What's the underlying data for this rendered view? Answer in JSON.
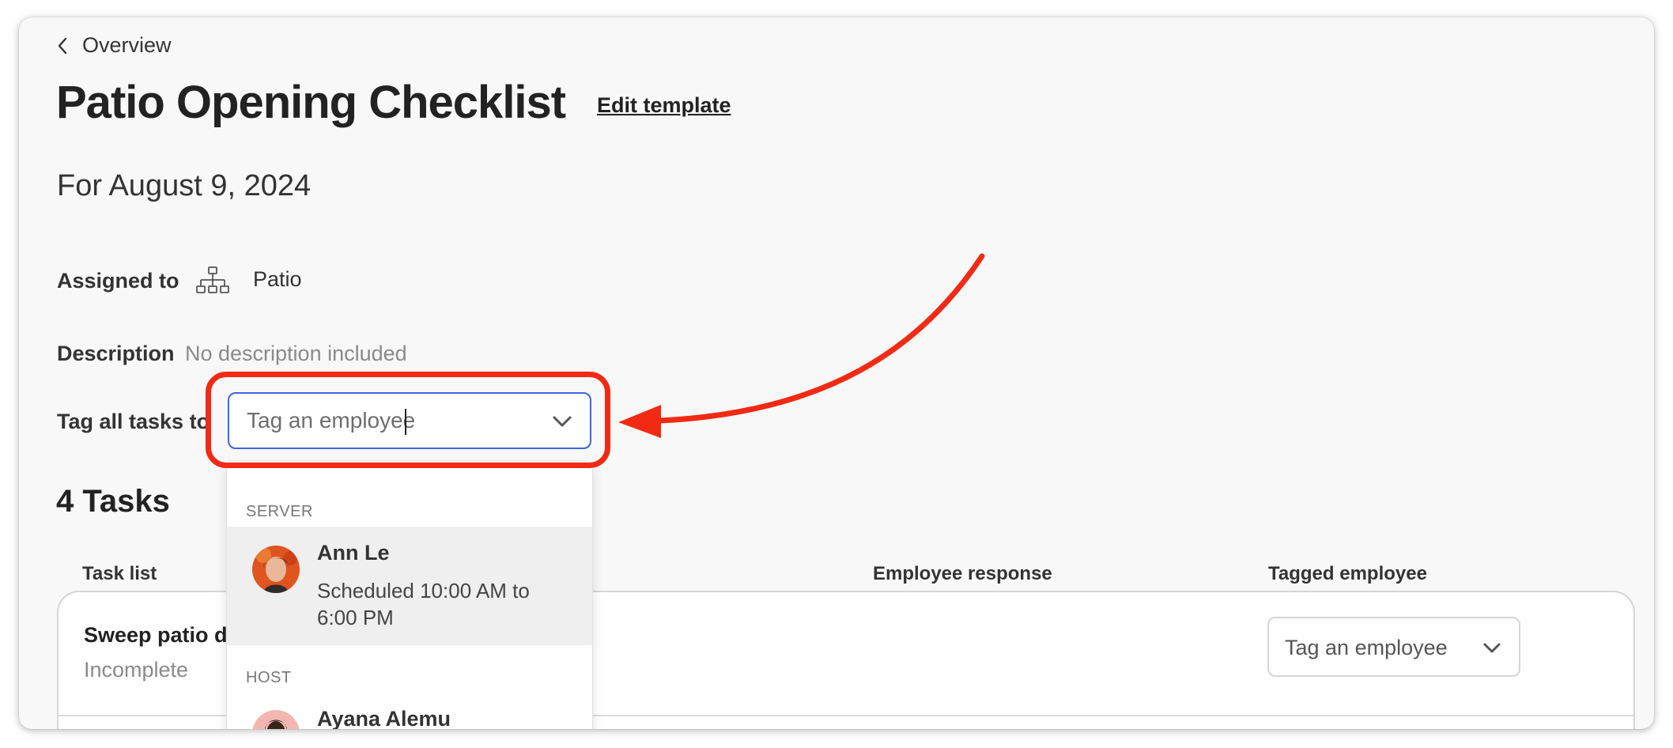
{
  "breadcrumb": {
    "label": "Overview"
  },
  "header": {
    "title": "Patio Opening Checklist",
    "edit_label": "Edit template"
  },
  "date_line": "For August 9, 2024",
  "details": {
    "assigned_label": "Assigned to",
    "assigned_value": "Patio",
    "description_label": "Description",
    "description_value": "No description included",
    "tag_label": "Tag all tasks to",
    "tag_placeholder": "Tag an employee"
  },
  "tasks": {
    "heading": "4 Tasks",
    "columns": [
      "Task list",
      "Employee response",
      "Tagged employee"
    ],
    "rows": [
      {
        "name": "Sweep patio de",
        "status": "Incomplete",
        "tag_placeholder": "Tag an employee"
      }
    ]
  },
  "dropdown": {
    "groups": [
      {
        "label": "SERVER",
        "options": [
          {
            "name": "Ann Le",
            "detail": "Scheduled 10:00 AM to 6:00 PM"
          }
        ]
      },
      {
        "label": "HOST",
        "options": [
          {
            "name": "Ayana Alemu"
          }
        ]
      }
    ]
  },
  "colors": {
    "highlight": "#f22a14",
    "focus_border": "#3b66e6",
    "background": "#f8f8f8"
  },
  "icons": [
    "chevron-left-icon",
    "org-chart-icon",
    "chevron-down-icon"
  ]
}
